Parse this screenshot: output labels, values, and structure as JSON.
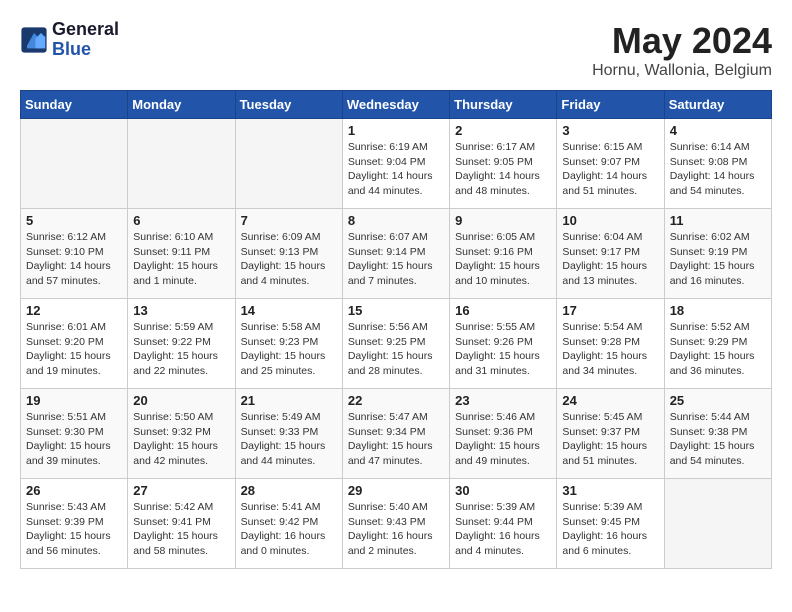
{
  "header": {
    "logo_line1": "General",
    "logo_line2": "Blue",
    "title": "May 2024",
    "subtitle": "Hornu, Wallonia, Belgium"
  },
  "columns": [
    "Sunday",
    "Monday",
    "Tuesday",
    "Wednesday",
    "Thursday",
    "Friday",
    "Saturday"
  ],
  "weeks": [
    [
      {
        "day": "",
        "sunrise": "",
        "sunset": "",
        "daylight": ""
      },
      {
        "day": "",
        "sunrise": "",
        "sunset": "",
        "daylight": ""
      },
      {
        "day": "",
        "sunrise": "",
        "sunset": "",
        "daylight": ""
      },
      {
        "day": "1",
        "sunrise": "Sunrise: 6:19 AM",
        "sunset": "Sunset: 9:04 PM",
        "daylight": "Daylight: 14 hours and 44 minutes."
      },
      {
        "day": "2",
        "sunrise": "Sunrise: 6:17 AM",
        "sunset": "Sunset: 9:05 PM",
        "daylight": "Daylight: 14 hours and 48 minutes."
      },
      {
        "day": "3",
        "sunrise": "Sunrise: 6:15 AM",
        "sunset": "Sunset: 9:07 PM",
        "daylight": "Daylight: 14 hours and 51 minutes."
      },
      {
        "day": "4",
        "sunrise": "Sunrise: 6:14 AM",
        "sunset": "Sunset: 9:08 PM",
        "daylight": "Daylight: 14 hours and 54 minutes."
      }
    ],
    [
      {
        "day": "5",
        "sunrise": "Sunrise: 6:12 AM",
        "sunset": "Sunset: 9:10 PM",
        "daylight": "Daylight: 14 hours and 57 minutes."
      },
      {
        "day": "6",
        "sunrise": "Sunrise: 6:10 AM",
        "sunset": "Sunset: 9:11 PM",
        "daylight": "Daylight: 15 hours and 1 minute."
      },
      {
        "day": "7",
        "sunrise": "Sunrise: 6:09 AM",
        "sunset": "Sunset: 9:13 PM",
        "daylight": "Daylight: 15 hours and 4 minutes."
      },
      {
        "day": "8",
        "sunrise": "Sunrise: 6:07 AM",
        "sunset": "Sunset: 9:14 PM",
        "daylight": "Daylight: 15 hours and 7 minutes."
      },
      {
        "day": "9",
        "sunrise": "Sunrise: 6:05 AM",
        "sunset": "Sunset: 9:16 PM",
        "daylight": "Daylight: 15 hours and 10 minutes."
      },
      {
        "day": "10",
        "sunrise": "Sunrise: 6:04 AM",
        "sunset": "Sunset: 9:17 PM",
        "daylight": "Daylight: 15 hours and 13 minutes."
      },
      {
        "day": "11",
        "sunrise": "Sunrise: 6:02 AM",
        "sunset": "Sunset: 9:19 PM",
        "daylight": "Daylight: 15 hours and 16 minutes."
      }
    ],
    [
      {
        "day": "12",
        "sunrise": "Sunrise: 6:01 AM",
        "sunset": "Sunset: 9:20 PM",
        "daylight": "Daylight: 15 hours and 19 minutes."
      },
      {
        "day": "13",
        "sunrise": "Sunrise: 5:59 AM",
        "sunset": "Sunset: 9:22 PM",
        "daylight": "Daylight: 15 hours and 22 minutes."
      },
      {
        "day": "14",
        "sunrise": "Sunrise: 5:58 AM",
        "sunset": "Sunset: 9:23 PM",
        "daylight": "Daylight: 15 hours and 25 minutes."
      },
      {
        "day": "15",
        "sunrise": "Sunrise: 5:56 AM",
        "sunset": "Sunset: 9:25 PM",
        "daylight": "Daylight: 15 hours and 28 minutes."
      },
      {
        "day": "16",
        "sunrise": "Sunrise: 5:55 AM",
        "sunset": "Sunset: 9:26 PM",
        "daylight": "Daylight: 15 hours and 31 minutes."
      },
      {
        "day": "17",
        "sunrise": "Sunrise: 5:54 AM",
        "sunset": "Sunset: 9:28 PM",
        "daylight": "Daylight: 15 hours and 34 minutes."
      },
      {
        "day": "18",
        "sunrise": "Sunrise: 5:52 AM",
        "sunset": "Sunset: 9:29 PM",
        "daylight": "Daylight: 15 hours and 36 minutes."
      }
    ],
    [
      {
        "day": "19",
        "sunrise": "Sunrise: 5:51 AM",
        "sunset": "Sunset: 9:30 PM",
        "daylight": "Daylight: 15 hours and 39 minutes."
      },
      {
        "day": "20",
        "sunrise": "Sunrise: 5:50 AM",
        "sunset": "Sunset: 9:32 PM",
        "daylight": "Daylight: 15 hours and 42 minutes."
      },
      {
        "day": "21",
        "sunrise": "Sunrise: 5:49 AM",
        "sunset": "Sunset: 9:33 PM",
        "daylight": "Daylight: 15 hours and 44 minutes."
      },
      {
        "day": "22",
        "sunrise": "Sunrise: 5:47 AM",
        "sunset": "Sunset: 9:34 PM",
        "daylight": "Daylight: 15 hours and 47 minutes."
      },
      {
        "day": "23",
        "sunrise": "Sunrise: 5:46 AM",
        "sunset": "Sunset: 9:36 PM",
        "daylight": "Daylight: 15 hours and 49 minutes."
      },
      {
        "day": "24",
        "sunrise": "Sunrise: 5:45 AM",
        "sunset": "Sunset: 9:37 PM",
        "daylight": "Daylight: 15 hours and 51 minutes."
      },
      {
        "day": "25",
        "sunrise": "Sunrise: 5:44 AM",
        "sunset": "Sunset: 9:38 PM",
        "daylight": "Daylight: 15 hours and 54 minutes."
      }
    ],
    [
      {
        "day": "26",
        "sunrise": "Sunrise: 5:43 AM",
        "sunset": "Sunset: 9:39 PM",
        "daylight": "Daylight: 15 hours and 56 minutes."
      },
      {
        "day": "27",
        "sunrise": "Sunrise: 5:42 AM",
        "sunset": "Sunset: 9:41 PM",
        "daylight": "Daylight: 15 hours and 58 minutes."
      },
      {
        "day": "28",
        "sunrise": "Sunrise: 5:41 AM",
        "sunset": "Sunset: 9:42 PM",
        "daylight": "Daylight: 16 hours and 0 minutes."
      },
      {
        "day": "29",
        "sunrise": "Sunrise: 5:40 AM",
        "sunset": "Sunset: 9:43 PM",
        "daylight": "Daylight: 16 hours and 2 minutes."
      },
      {
        "day": "30",
        "sunrise": "Sunrise: 5:39 AM",
        "sunset": "Sunset: 9:44 PM",
        "daylight": "Daylight: 16 hours and 4 minutes."
      },
      {
        "day": "31",
        "sunrise": "Sunrise: 5:39 AM",
        "sunset": "Sunset: 9:45 PM",
        "daylight": "Daylight: 16 hours and 6 minutes."
      },
      {
        "day": "",
        "sunrise": "",
        "sunset": "",
        "daylight": ""
      }
    ]
  ]
}
